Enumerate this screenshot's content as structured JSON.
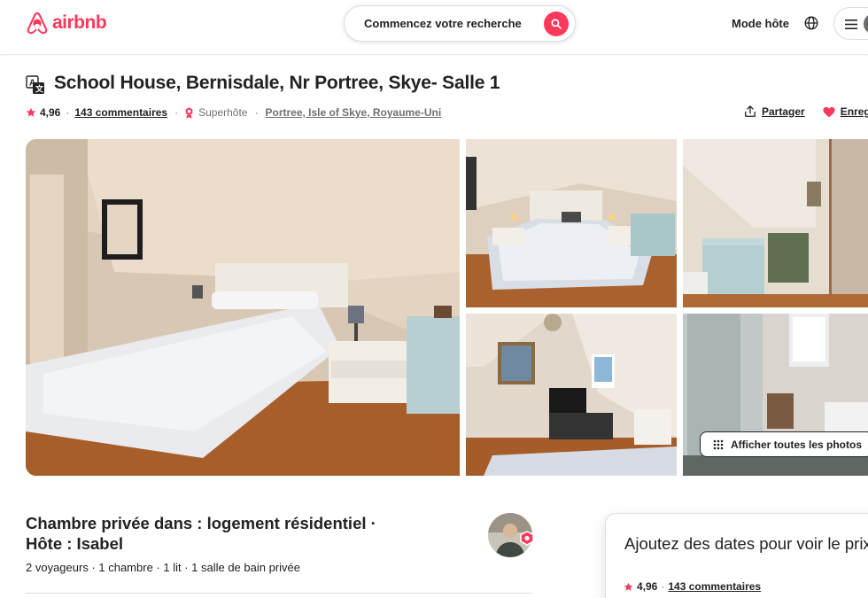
{
  "header": {
    "logo_text": "airbnb",
    "search_placeholder": "Commencez votre recherche",
    "host_link": "Mode hôte",
    "icons": [
      "airbnb-logo",
      "search-icon",
      "globe-icon",
      "menu-icon"
    ],
    "brand_color": "#ff385c"
  },
  "listing": {
    "title": "School House, Bernisdale, Nr Portree, Skye- Salle 1",
    "rating": "4,96",
    "reviews_link": "143 commentaires",
    "superhost": "Superhôte",
    "location": "Portree, Isle of Skye, Royaume-Uni",
    "share_label": "Partager",
    "save_label": "Enregistrer"
  },
  "photos": {
    "show_all_label": "Afficher toutes les photos"
  },
  "summary": {
    "subtitle_line1": "Chambre privée dans : logement résidentiel ·",
    "subtitle_line2": "Hôte : Isabel",
    "details": "2 voyageurs · 1 chambre · 1 lit · 1 salle de bain privée"
  },
  "booking": {
    "title": "Ajoutez des dates pour voir le prix",
    "rating": "4,96",
    "reviews_link": "143 commentaires"
  }
}
